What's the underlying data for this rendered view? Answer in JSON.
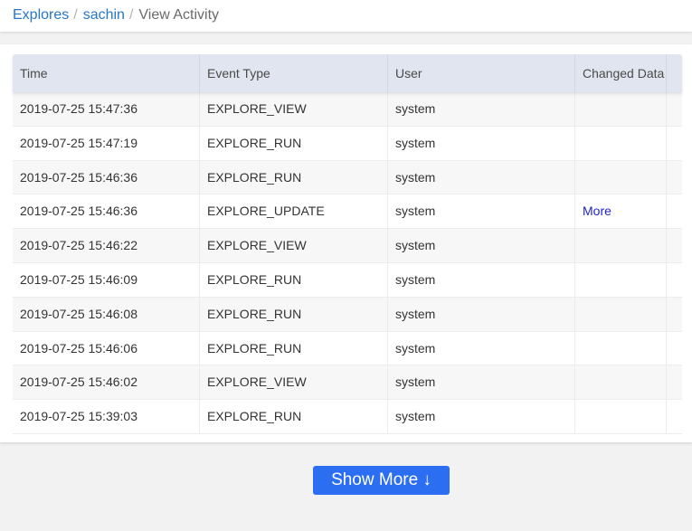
{
  "breadcrumb": {
    "items": [
      {
        "label": "Explores",
        "link": true
      },
      {
        "label": "sachin",
        "link": true
      },
      {
        "label": "View Activity",
        "link": false
      }
    ],
    "separator": "/"
  },
  "table": {
    "columns": [
      "Time",
      "Event Type",
      "User",
      "Changed Data",
      ""
    ],
    "rows": [
      {
        "time": "2019-07-25 15:47:36",
        "event": "EXPLORE_VIEW",
        "user": "system",
        "changed": ""
      },
      {
        "time": "2019-07-25 15:47:19",
        "event": "EXPLORE_RUN",
        "user": "system",
        "changed": ""
      },
      {
        "time": "2019-07-25 15:46:36",
        "event": "EXPLORE_RUN",
        "user": "system",
        "changed": ""
      },
      {
        "time": "2019-07-25 15:46:36",
        "event": "EXPLORE_UPDATE",
        "user": "system",
        "changed": "More"
      },
      {
        "time": "2019-07-25 15:46:22",
        "event": "EXPLORE_VIEW",
        "user": "system",
        "changed": ""
      },
      {
        "time": "2019-07-25 15:46:09",
        "event": "EXPLORE_RUN",
        "user": "system",
        "changed": ""
      },
      {
        "time": "2019-07-25 15:46:08",
        "event": "EXPLORE_RUN",
        "user": "system",
        "changed": ""
      },
      {
        "time": "2019-07-25 15:46:06",
        "event": "EXPLORE_RUN",
        "user": "system",
        "changed": ""
      },
      {
        "time": "2019-07-25 15:46:02",
        "event": "EXPLORE_VIEW",
        "user": "system",
        "changed": ""
      },
      {
        "time": "2019-07-25 15:39:03",
        "event": "EXPLORE_RUN",
        "user": "system",
        "changed": ""
      }
    ]
  },
  "show_more": {
    "label": "Show More ↓"
  },
  "colors": {
    "link": "#2677c9",
    "header_bg": "#e1e5ef",
    "button_bg": "#2c6ef2",
    "more_link": "#2222cc"
  }
}
